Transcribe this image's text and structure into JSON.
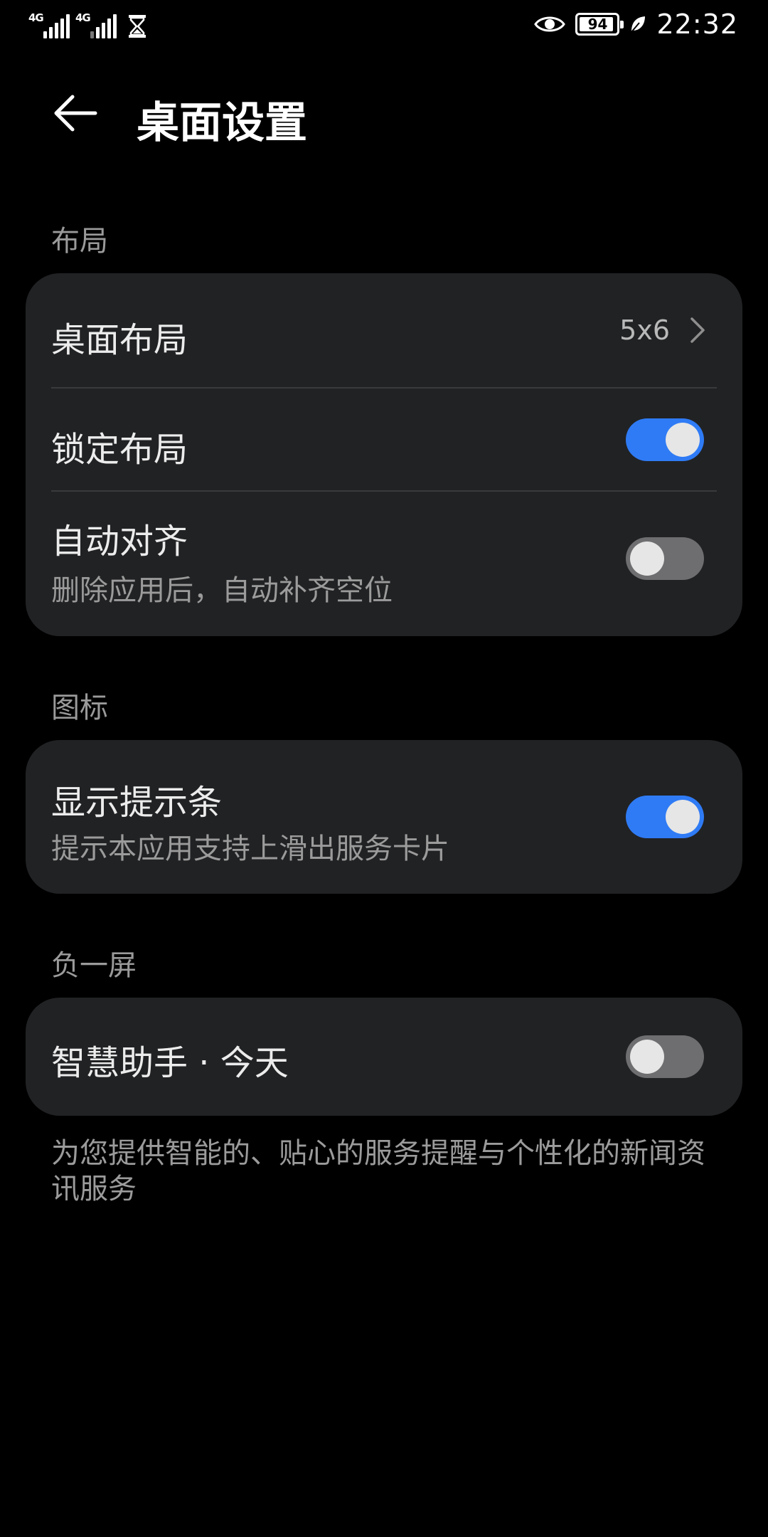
{
  "status_bar": {
    "sim1_tag": "4G",
    "sim2_tag": "4G",
    "battery": "94",
    "battery_level": 0.94,
    "time": "22:32",
    "icons": [
      "signal-icon",
      "signal-icon",
      "hourglass-icon",
      "eye-icon",
      "battery-icon",
      "leaf-icon"
    ]
  },
  "header": {
    "title": "桌面设置",
    "back_icon": "back-arrow-icon"
  },
  "sections": {
    "layout": {
      "label": "布局",
      "desktop_layout": {
        "title": "桌面布局",
        "value": "5x6"
      },
      "lock_layout": {
        "title": "锁定布局",
        "enabled": true
      },
      "auto_align": {
        "title": "自动对齐",
        "subtitle": "删除应用后，自动补齐空位",
        "enabled": false
      }
    },
    "icons": {
      "label": "图标",
      "show_hint_bar": {
        "title": "显示提示条",
        "subtitle": "提示本应用支持上滑出服务卡片",
        "enabled": true
      }
    },
    "minus_one_screen": {
      "label": "负一屏",
      "smart_assistant": {
        "title": "智慧助手 · 今天",
        "enabled": false
      },
      "note": "为您提供智能的、贴心的服务提醒与个性化的新闻资讯服务"
    }
  },
  "colors": {
    "background": "#000000",
    "card": "#212224",
    "accent": "#2f7bf5",
    "toggle_off": "#6e6e70"
  }
}
